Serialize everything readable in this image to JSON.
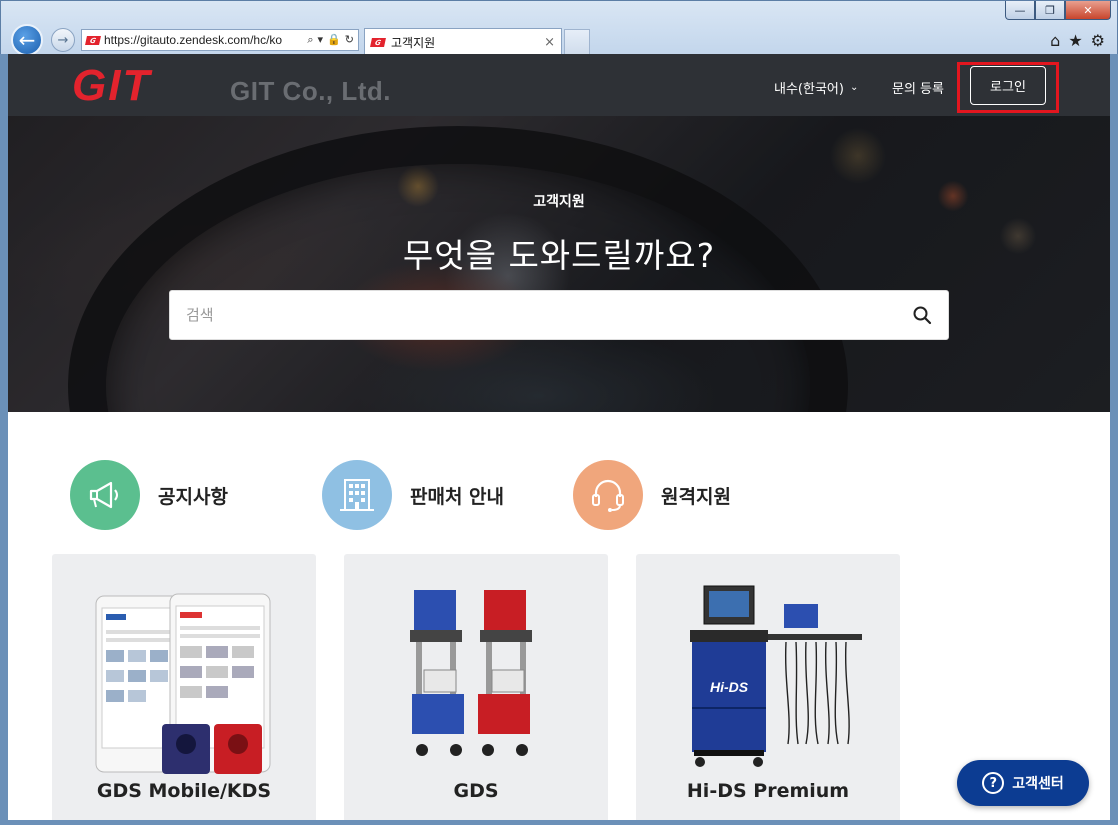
{
  "browser": {
    "address": "https://gitauto.zendesk.com/hc/ko",
    "tab_title": "고객지원",
    "tab_close": "×",
    "window_buttons": {
      "minimize": "—",
      "restore": "❐",
      "close": "✕"
    }
  },
  "header": {
    "logo_mark": "GIT",
    "logo_text": "GIT Co., Ltd.",
    "lang": "내수(한국어)",
    "submit_request": "문의 등록",
    "login": "로그인"
  },
  "hero": {
    "subtitle": "고객지원",
    "title": "무엇을 도와드릴까요?",
    "search_placeholder": "검색"
  },
  "categories": [
    {
      "label": "공지사항",
      "color": "#5bbf8f",
      "icon": "megaphone-icon"
    },
    {
      "label": "판매처 안내",
      "color": "#8fc0e3",
      "icon": "building-icon"
    },
    {
      "label": "원격지원",
      "color": "#f0a67c",
      "icon": "headset-icon"
    }
  ],
  "products": [
    {
      "label": "GDS Mobile/KDS",
      "icon": "tablet-device-image"
    },
    {
      "label": "GDS",
      "icon": "diagnostic-cart-image"
    },
    {
      "label": "Hi-DS Premium",
      "icon": "diagnostic-station-image"
    }
  ],
  "help": {
    "label": "고객센터"
  },
  "colors": {
    "brand_red": "#e3232d",
    "header_bg": "#2e3136",
    "help_blue": "#0c3c92",
    "highlight_red": "#e3161f"
  }
}
